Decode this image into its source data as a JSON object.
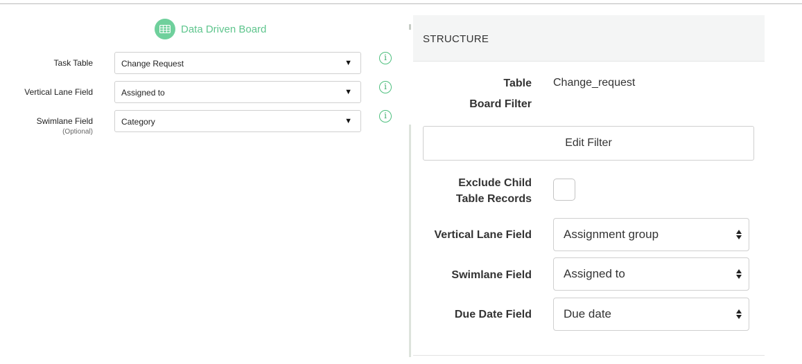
{
  "left_panel": {
    "title": "Data Driven Board",
    "icon": "board-table-icon",
    "accent_color": "#5ec58d",
    "fields": [
      {
        "label": "Task Table",
        "sublabel": "",
        "value": "Change Request"
      },
      {
        "label": "Vertical Lane Field",
        "sublabel": "",
        "value": "Assigned to"
      },
      {
        "label": "Swimlane Field",
        "sublabel": "(Optional)",
        "value": "Category"
      }
    ],
    "info_glyph": "i",
    "caret_glyph": "▼"
  },
  "right_panel": {
    "header": "STRUCTURE",
    "table_label": "Table",
    "table_value": "Change_request",
    "board_filter_label": "Board Filter",
    "edit_filter_label": "Edit Filter",
    "exclude_child_label_line1": "Exclude Child",
    "exclude_child_label_line2": "Table Records",
    "exclude_child_checked": false,
    "vertical_lane_label": "Vertical Lane Field",
    "vertical_lane_value": "Assignment group",
    "swimlane_label": "Swimlane Field",
    "swimlane_value": "Assigned to",
    "due_date_label": "Due Date Field",
    "due_date_value": "Due date"
  }
}
